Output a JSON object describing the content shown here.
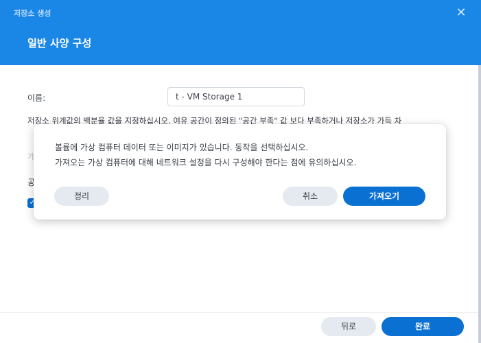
{
  "window": {
    "title": "저장소 생성",
    "close_glyph": "✕",
    "step_title": "일반 사양 구성"
  },
  "form": {
    "name_label": "이름:",
    "name_value": "t - VM Storage 1",
    "description": "저장소 위계값의 백분율 값을 지정하십시오. 여유 공간이 정의된 \"공간 부족\" 값 보다 부족하거나 저장소가 가득 차",
    "faded_row_text": "가",
    "partial_label": "공",
    "checkbox_checked": true
  },
  "footer": {
    "back_label": "뒤로",
    "finish_label": "완료"
  },
  "dialog": {
    "line1": "볼륨에 가상 컴퓨터 데이터 또는 이미지가 있습니다. 동작을 선택하십시오.",
    "line2": "가져오는 가상 컴퓨터에 대해 네트워크 설정을 다시 구성해야 한다는 점에 유의하십시오.",
    "organize_label": "정리",
    "cancel_label": "취소",
    "import_label": "가져오기"
  },
  "colors": {
    "header_blue": "#1a87e6",
    "primary_button": "#0a70d1",
    "secondary_button": "#e5eaf0"
  },
  "icons": {
    "close": "close-icon",
    "checkbox": "check-icon"
  }
}
